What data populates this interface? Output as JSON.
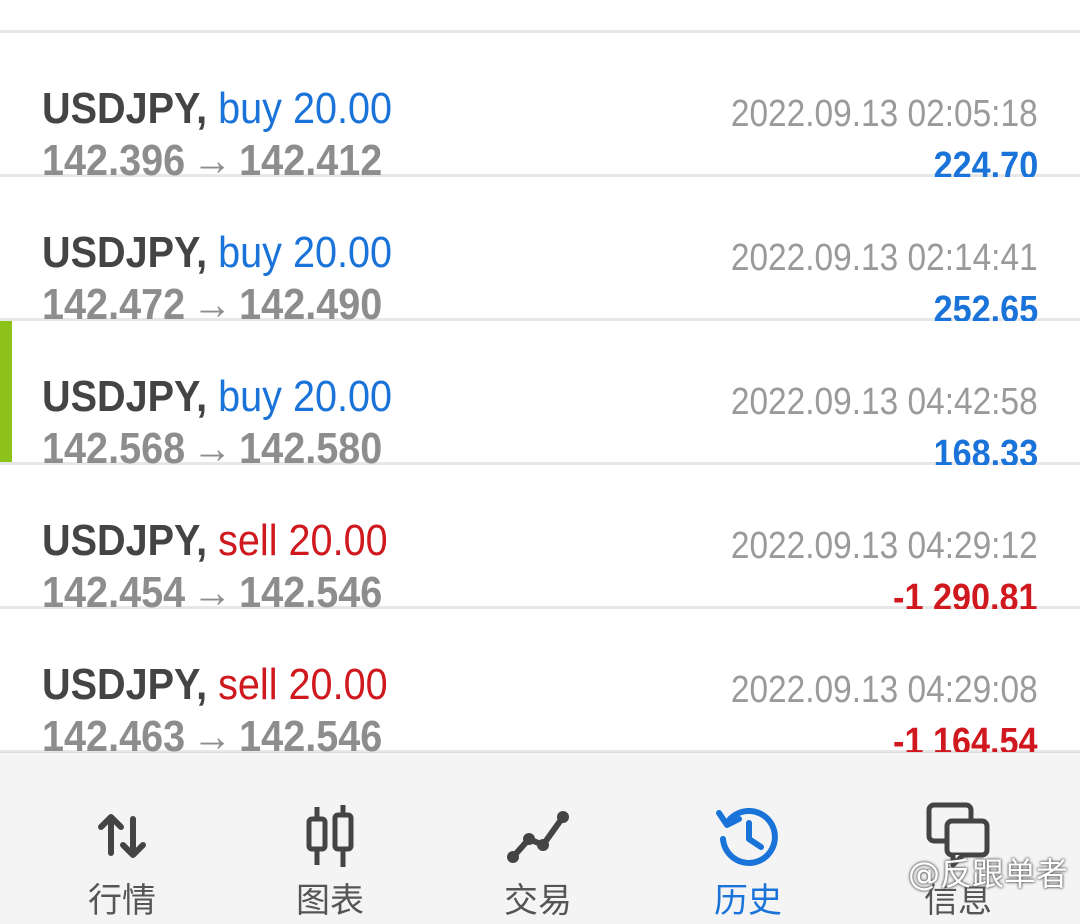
{
  "trades": [
    {
      "symbol": "USDJPY,",
      "type": "buy",
      "volume": "20.00",
      "open": "142.396",
      "close": "142.412",
      "time": "2022.09.13 02:05:18",
      "profit": "224.70"
    },
    {
      "symbol": "USDJPY,",
      "type": "buy",
      "volume": "20.00",
      "open": "142.472",
      "close": "142.490",
      "time": "2022.09.13 02:14:41",
      "profit": "252.65"
    },
    {
      "symbol": "USDJPY,",
      "type": "buy",
      "volume": "20.00",
      "open": "142.568",
      "close": "142.580",
      "time": "2022.09.13 04:42:58",
      "profit": "168.33",
      "selected": true
    },
    {
      "symbol": "USDJPY,",
      "type": "sell",
      "volume": "20.00",
      "open": "142.454",
      "close": "142.546",
      "time": "2022.09.13 04:29:12",
      "profit": "-1 290.81"
    },
    {
      "symbol": "USDJPY,",
      "type": "sell",
      "volume": "20.00",
      "open": "142.463",
      "close": "142.546",
      "time": "2022.09.13 04:29:08",
      "profit": "-1 164.54"
    }
  ],
  "arrow": "→",
  "nav": [
    {
      "label": "行情",
      "icon": "quotes-arrows-icon"
    },
    {
      "label": "图表",
      "icon": "candlestick-chart-icon"
    },
    {
      "label": "交易",
      "icon": "trade-line-icon"
    },
    {
      "label": "历史",
      "icon": "history-clock-icon",
      "active": true
    },
    {
      "label": "信息",
      "icon": "messages-icon"
    }
  ],
  "watermark": "@反跟单者",
  "colors": {
    "buy": "#1a73d9",
    "sell": "#d0191f",
    "selected_bar": "#8cc21a"
  }
}
